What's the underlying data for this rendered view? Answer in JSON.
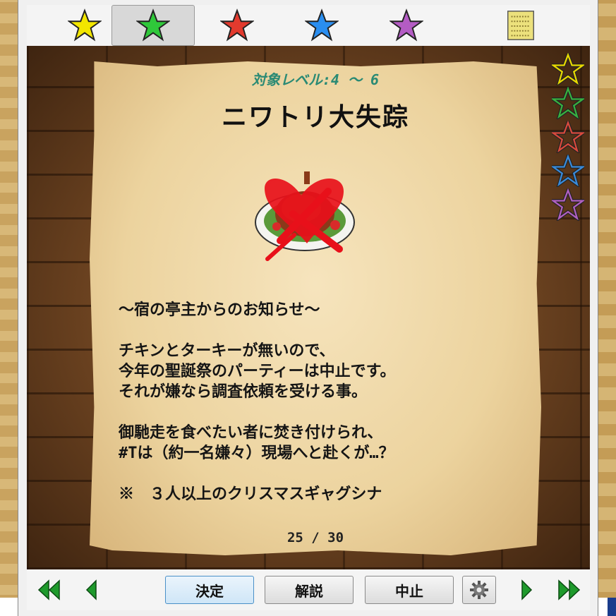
{
  "toolbar": {
    "tabs": [
      {
        "icon": "yellow-star-icon",
        "color": "#f2e600",
        "active": false
      },
      {
        "icon": "green-star-icon",
        "color": "#2fc83a",
        "active": true
      },
      {
        "icon": "red-star-icon",
        "color": "#e23a2e",
        "active": false
      },
      {
        "icon": "blue-star-icon",
        "color": "#2a8ef0",
        "active": false
      },
      {
        "icon": "purple-star-icon",
        "color": "#b45cc4",
        "active": false
      },
      {
        "icon": "scroll-icon",
        "color": "#e8d880",
        "active": false
      }
    ]
  },
  "quest": {
    "level": "対象レベル:4 ～ 6",
    "title": "ニワトリ大失踪",
    "dish_icon": "crossed-out-roast-chicken-icon",
    "lines": [
      "～宿の亭主からのお知らせ～",
      "",
      "チキンとターキーが無いので、",
      "今年の聖誕祭のパーティーは中止です。",
      "それが嫌なら調査依頼を受ける事。",
      "",
      "御馳走を食べたい者に焚き付けられ、",
      "#Tは（約一名嫌々）現場へと赴くが…？",
      "",
      "※　３人以上のクリスマスギャグシナ"
    ],
    "page": "25 / 30"
  },
  "side_stars": [
    {
      "icon": "outline-yellow-star-icon",
      "color": "#e8d800"
    },
    {
      "icon": "outline-green-star-icon",
      "color": "#38b040"
    },
    {
      "icon": "outline-red-star-icon",
      "color": "#d84a3c"
    },
    {
      "icon": "outline-blue-star-icon",
      "color": "#3a8ad8"
    },
    {
      "icon": "outline-purple-star-icon",
      "color": "#b060c0"
    }
  ],
  "bottombar": {
    "first_icon": "double-left-arrow-icon",
    "prev_icon": "left-arrow-icon",
    "decide_label": "決定",
    "explain_label": "解説",
    "cancel_label": "中止",
    "settings_icon": "gear-icon",
    "next_icon": "right-arrow-icon",
    "last_icon": "double-right-arrow-icon",
    "arrow_color": "#1e9a2c"
  }
}
